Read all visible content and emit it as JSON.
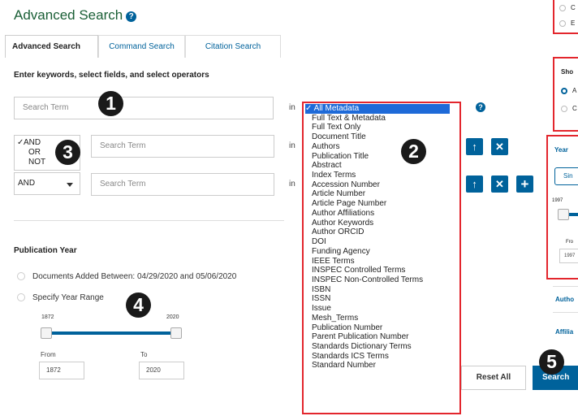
{
  "header": {
    "title": "Advanced Search",
    "help_icon": "?"
  },
  "tabs": [
    {
      "label": "Advanced Search",
      "active": true
    },
    {
      "label": "Command Search",
      "active": false
    },
    {
      "label": "Citation Search",
      "active": false
    }
  ],
  "instruction": "Enter keywords, select fields, and select operators",
  "rows": [
    {
      "placeholder": "Search Term",
      "in_label": "in"
    },
    {
      "placeholder": "Search Term",
      "in_label": "in"
    },
    {
      "placeholder": "Search Term",
      "in_label": "in"
    }
  ],
  "operator_dropdown": {
    "options": [
      "AND",
      "OR",
      "NOT"
    ],
    "checked": "AND",
    "check_mark": "✓"
  },
  "operator_select": {
    "value": "AND"
  },
  "row_buttons": {
    "up": "↑",
    "remove": "✕",
    "add": "+"
  },
  "help_icon_2": "?",
  "field_list": {
    "check_mark": "✓",
    "items": [
      "All Metadata",
      "Full Text & Metadata",
      "Full Text Only",
      "Document Title",
      "Authors",
      "Publication Title",
      "Abstract",
      "Index Terms",
      "Accession Number",
      "Article Number",
      "Article Page Number",
      "Author Affiliations",
      "Author Keywords",
      "Author ORCID",
      "DOI",
      "Funding Agency",
      "IEEE Terms",
      "INSPEC Controlled Terms",
      "INSPEC Non-Controlled Terms",
      "ISBN",
      "ISSN",
      "Issue",
      "Mesh_Terms",
      "Publication Number",
      "Parent Publication Number",
      "Standards Dictionary Terms",
      "Standards ICS Terms",
      "Standard Number"
    ]
  },
  "publication_year": {
    "label": "Publication Year",
    "option_added": "Documents Added Between: 04/29/2020 and 05/06/2020",
    "option_range": "Specify Year Range",
    "slider_min": "1872",
    "slider_max": "2020",
    "from_label": "From",
    "to_label": "To",
    "from_value": "1872",
    "to_value": "2020"
  },
  "buttons": {
    "reset": "Reset All",
    "search": "Search"
  },
  "badges": [
    "1",
    "2",
    "3",
    "4",
    "5"
  ],
  "right_panel": {
    "top_options": [
      "C",
      "E"
    ],
    "show_label": "Sho",
    "show_options": [
      "A",
      "C"
    ],
    "year_label": "Year",
    "single_button": "Sin",
    "slider_value": "1997",
    "from_label": "Fro",
    "from_value": "1997",
    "author_link": "Autho",
    "affiliation_link": "Affilia"
  },
  "colors": {
    "accent": "#00629b",
    "title_green": "#1a5f36",
    "highlight_red": "#e3262d",
    "selected_blue": "#1e6ad8"
  }
}
